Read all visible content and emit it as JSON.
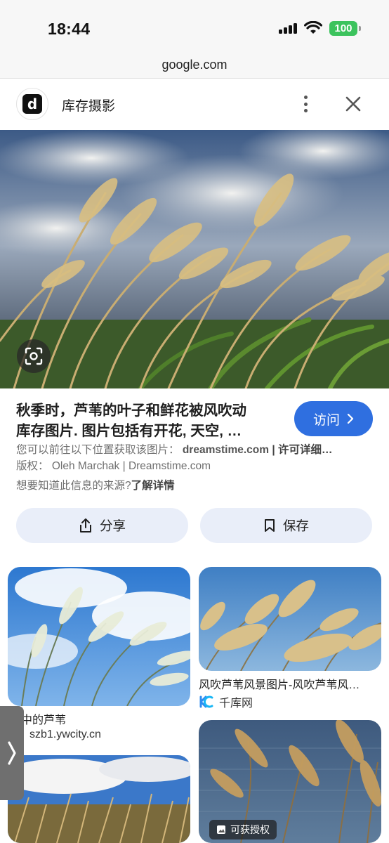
{
  "status": {
    "time": "18:44",
    "battery": "100"
  },
  "url": "google.com",
  "source": {
    "logo_letter": "d",
    "name": "库存摄影"
  },
  "result": {
    "title_line1": "秋季时，芦苇的叶子和鲜花被风吹动",
    "title_line2": "库存图片. 图片包括有开花, 天空, …",
    "visit_label": "访问",
    "available_prefix": "您可以前往以下位置获取该图片：",
    "available_site": "dreamstime.com",
    "available_suffix": " | 许可详细…",
    "copyright_label": "版权：",
    "copyright_value": "Oleh Marchak | Dreamstime.com",
    "source_question": "想要知道此信息的来源?",
    "learn_more": "了解详情"
  },
  "actions": {
    "share": "分享",
    "save": "保存"
  },
  "related": [
    {
      "caption": "中的芦苇",
      "source": "szb1.ywcity.cn"
    },
    {
      "caption": "风吹芦苇风景图片-风吹芦苇风…",
      "source": "千库网"
    },
    {
      "badge": "可获授权"
    }
  ],
  "icons": {
    "more": "more-vert-icon",
    "close": "close-icon",
    "lens": "lens-icon",
    "chevron": "chevron-right-icon",
    "share": "share-icon",
    "save": "bookmark-icon",
    "image": "image-icon",
    "side_tab": "chevron-right-icon"
  },
  "colors": {
    "accent": "#2f6fe0",
    "button_bg": "#e9eef9",
    "battery": "#3cc35d"
  }
}
